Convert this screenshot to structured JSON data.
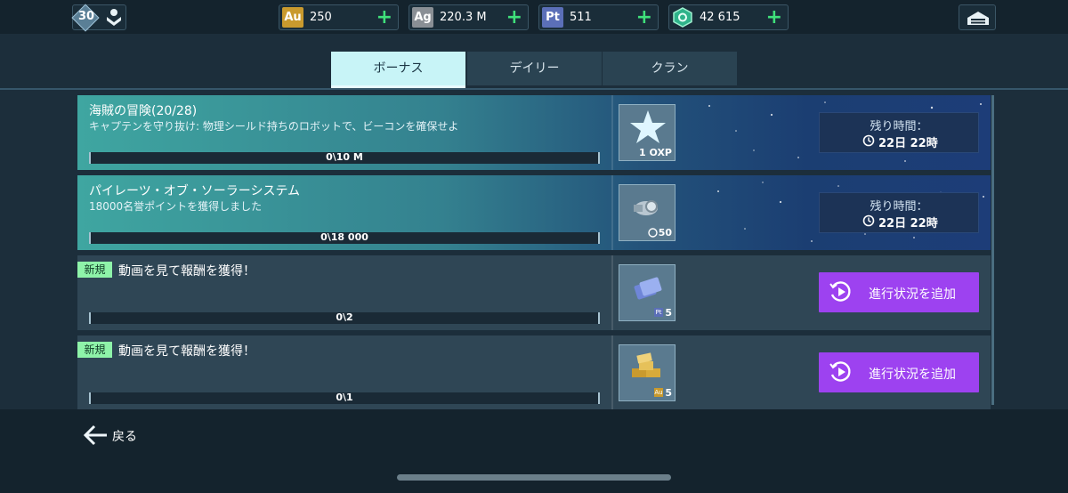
{
  "header": {
    "level": "30",
    "resources": [
      {
        "code": "Au",
        "value": "250",
        "color": "#c99a2e"
      },
      {
        "code": "Ag",
        "value": "220.3 M",
        "color": "#8a8f95"
      },
      {
        "code": "Pt",
        "value": "511",
        "color": "#5b6fb8"
      },
      {
        "code": "",
        "value": "42 615",
        "color": "#2fb38a"
      }
    ],
    "plus": "+"
  },
  "tabs": [
    {
      "label": "ボーナス",
      "active": true
    },
    {
      "label": "デイリー",
      "active": false
    },
    {
      "label": "クラン",
      "active": false
    }
  ],
  "quests": [
    {
      "title": "海賊の冒険(20/28)",
      "description": "キャプテンを守り抜け: 物理シールド持ちのロボットで、ビーコンを確保せよ",
      "progress": "0\\10 M",
      "reward_text": "1 OXP",
      "timer_label": "残り時間：",
      "timer_value": "22日 22時"
    },
    {
      "title": "パイレーツ・オブ・ソーラーシステム",
      "description": "18000名誉ポイントを獲得しました",
      "progress": "0\\18 000",
      "reward_text": "50",
      "timer_label": "残り時間：",
      "timer_value": "22日 22時"
    },
    {
      "badge": "新規",
      "title": "動画を見て報酬を獲得！",
      "progress": "0\\2",
      "reward_text": "5",
      "action_label": "進行状況を追加"
    },
    {
      "badge": "新規",
      "title": "動画を見て報酬を獲得！",
      "progress": "0\\1",
      "reward_text": "5",
      "action_label": "進行状況を追加"
    }
  ],
  "footer": {
    "back_label": "戻る"
  }
}
